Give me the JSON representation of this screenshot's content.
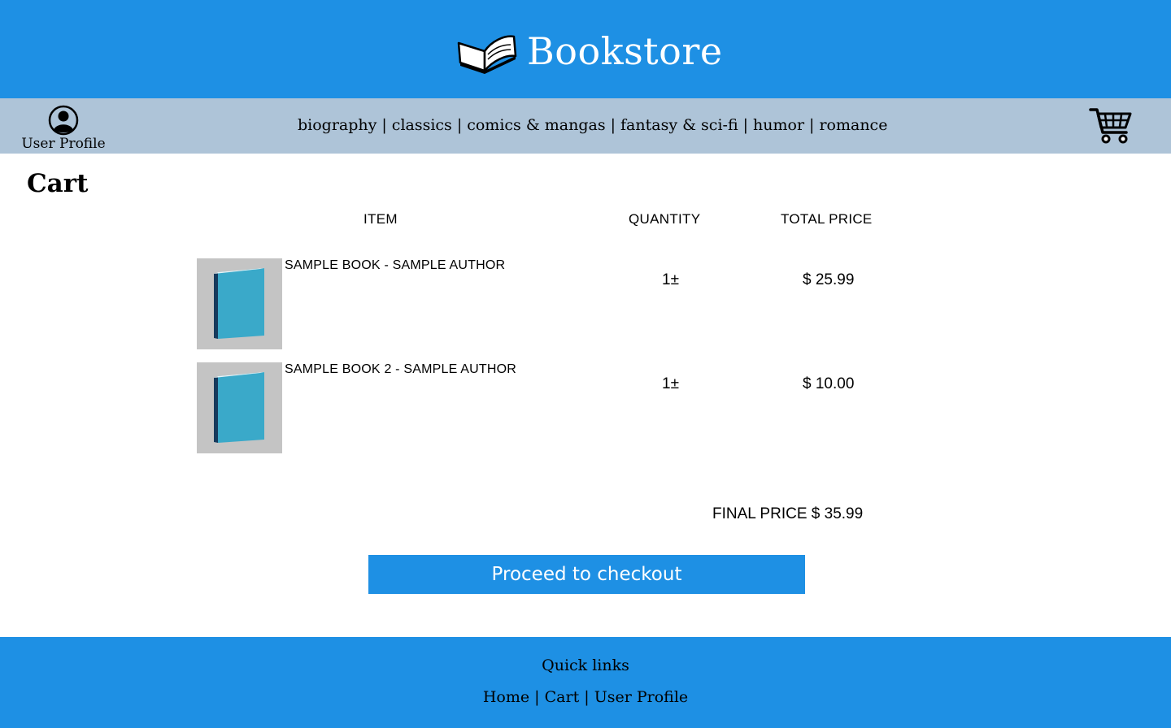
{
  "header": {
    "title": "Bookstore",
    "logo_icon": "open-book-icon"
  },
  "nav": {
    "profile_label": "User Profile",
    "profile_icon": "user-circle-icon",
    "categories": [
      "biography",
      "classics",
      "comics & mangas",
      "fantasy & sci-fi",
      "humor",
      "romance"
    ],
    "separator": "|",
    "cart_icon": "shopping-cart-icon"
  },
  "cart": {
    "title": "Cart",
    "columns": {
      "item": "ITEM",
      "quantity": "QUANTITY",
      "total": "TOTAL PRICE"
    },
    "items": [
      {
        "name": "SAMPLE BOOK - SAMPLE AUTHOR",
        "quantity": "1",
        "stepper": "±",
        "price": "$ 25.99"
      },
      {
        "name": "SAMPLE BOOK 2 - SAMPLE AUTHOR",
        "quantity": "1",
        "stepper": "±",
        "price": "$ 10.00"
      }
    ],
    "final_label": "FINAL PRICE",
    "final_price": "$ 35.99",
    "checkout_label": "Proceed to checkout"
  },
  "footer": {
    "title": "Quick links",
    "links": [
      "Home",
      "Cart",
      "User Profile"
    ],
    "separator": "|"
  },
  "colors": {
    "primary": "#1e90e4",
    "nav_bg": "#aec4d8",
    "thumb_bg": "#c4c4c4",
    "book_cover": "#3aa9c9",
    "book_spine": "#163a5c"
  }
}
